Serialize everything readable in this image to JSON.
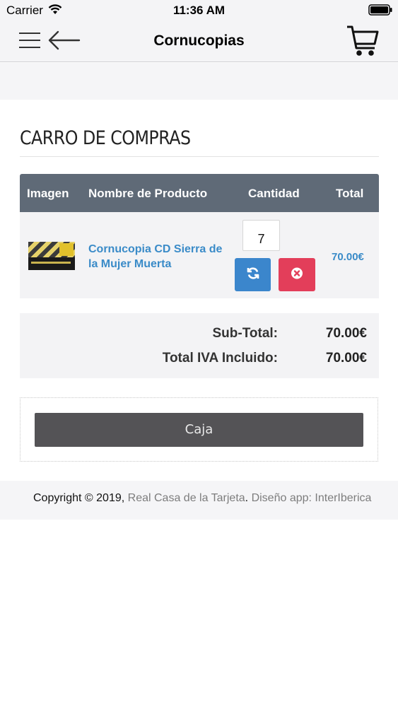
{
  "status_bar": {
    "carrier": "Carrier",
    "time": "11:36 AM"
  },
  "nav": {
    "title": "Cornucopias",
    "icons": [
      "menu-icon",
      "back-arrow-icon",
      "cart-icon"
    ]
  },
  "page": {
    "heading": "CARRO DE COMPRAS"
  },
  "table": {
    "headers": {
      "image": "Imagen",
      "name": "Nombre de Producto",
      "quantity": "Cantidad",
      "total": "Total"
    },
    "rows": [
      {
        "product_name": "Cornucopia CD Sierra de la Mujer Muerta",
        "quantity": "7",
        "total": "70.00€"
      }
    ]
  },
  "totals": {
    "subtotal_label": "Sub-Total:",
    "subtotal_value": "70.00€",
    "total_label": "Total IVA Incluido:",
    "total_value": "70.00€"
  },
  "checkout": {
    "label": "Caja"
  },
  "footer": {
    "prefix": "Copyright © 2019, ",
    "company_link": "Real Casa de la Tarjeta",
    "separator": ". ",
    "design_text": "Diseño app: InterIberica"
  },
  "colors": {
    "header_bg": "#5f6a77",
    "link": "#3a8bc8",
    "refresh": "#3b86cc",
    "remove": "#e33e5a",
    "checkout": "#545356"
  }
}
